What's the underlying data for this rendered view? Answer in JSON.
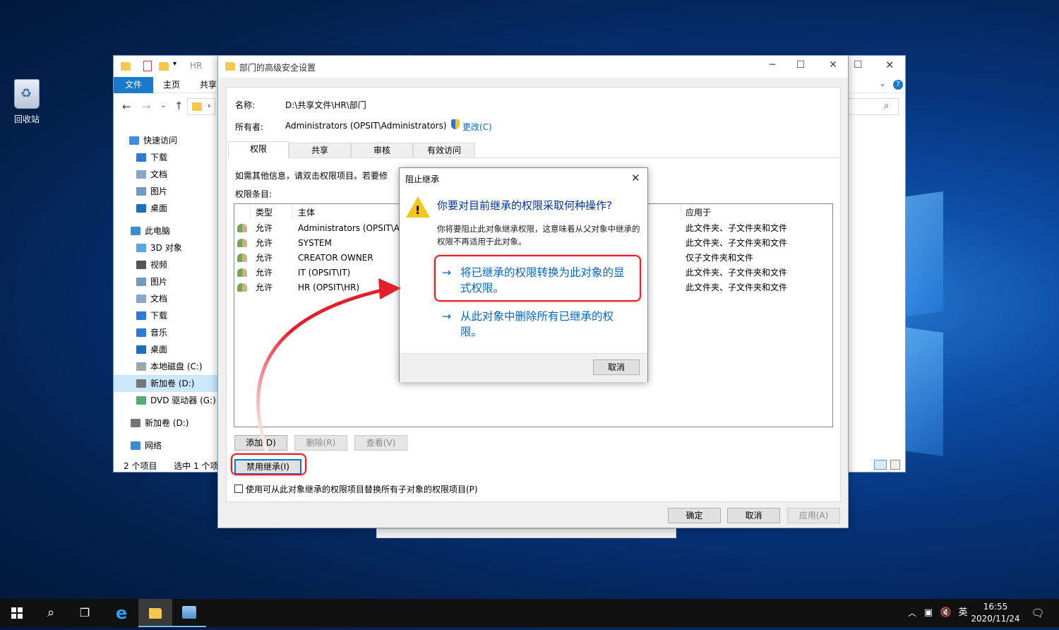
{
  "desktop": {
    "recycle_bin": "回收站"
  },
  "explorer": {
    "title": "HR",
    "ribbon": {
      "file": "文件",
      "home": "主页",
      "share": "共享"
    },
    "nav": [
      {
        "label": "快速访问",
        "icon": "star-icon"
      },
      {
        "label": "下载",
        "icon": "download-icon"
      },
      {
        "label": "文档",
        "icon": "document-icon"
      },
      {
        "label": "图片",
        "icon": "picture-icon"
      },
      {
        "label": "桌面",
        "icon": "desktop-icon"
      },
      {
        "label": "此电脑",
        "icon": "computer-icon"
      },
      {
        "label": "3D 对象",
        "icon": "cube-icon"
      },
      {
        "label": "视频",
        "icon": "video-icon"
      },
      {
        "label": "图片",
        "icon": "picture-icon"
      },
      {
        "label": "文档",
        "icon": "document-icon"
      },
      {
        "label": "下载",
        "icon": "download-icon"
      },
      {
        "label": "音乐",
        "icon": "music-icon"
      },
      {
        "label": "桌面",
        "icon": "desktop-icon"
      },
      {
        "label": "本地磁盘 (C:)",
        "icon": "drive-icon"
      },
      {
        "label": "新加卷 (D:)",
        "icon": "drive-icon"
      },
      {
        "label": "DVD 驱动器 (G:) S",
        "icon": "dvd-icon"
      },
      {
        "label": "新加卷 (D:)",
        "icon": "drive-icon"
      },
      {
        "label": "网络",
        "icon": "network-icon"
      }
    ],
    "status": {
      "count": "2 个项目",
      "selected": "选中 1 个项"
    }
  },
  "security": {
    "title": "部门的高级安全设置",
    "name_label": "名称:",
    "name_value": "D:\\共享文件\\HR\\部门",
    "owner_label": "所有者:",
    "owner_value": "Administrators (OPSIT\\Administrators)",
    "change_link": "更改(C)",
    "tabs": [
      "权限",
      "共享",
      "审核",
      "有效访问"
    ],
    "info_text": "如需其他信息，请双击权限项目。若要修",
    "entries_label": "权限条目:",
    "columns": {
      "type": "类型",
      "principal": "主体",
      "applies": "应用于"
    },
    "rows": [
      {
        "type": "允许",
        "principal": "Administrators (OPSIT\\Ad",
        "applies": "此文件夹、子文件夹和文件"
      },
      {
        "type": "允许",
        "principal": "SYSTEM",
        "applies": "此文件夹、子文件夹和文件"
      },
      {
        "type": "允许",
        "principal": "CREATOR OWNER",
        "applies": "仅子文件夹和文件"
      },
      {
        "type": "允许",
        "principal": "IT (OPSIT\\IT)",
        "applies": "此文件夹、子文件夹和文件"
      },
      {
        "type": "允许",
        "principal": "HR (OPSIT\\HR)",
        "applies": "此文件夹、子文件夹和文件"
      }
    ],
    "add": "添加(D)",
    "remove": "删除(R)",
    "view": "查看(V)",
    "disable_inheritance": "禁用继承(I)",
    "replace_checkbox": "使用可从此对象继承的权限项目替换所有子对象的权限项目(P)",
    "ok": "确定",
    "cancel": "取消",
    "apply": "应用(A)"
  },
  "popup": {
    "title": "阻止继承",
    "question": "你要对目前继承的权限采取何种操作?",
    "description": "你将要阻止此对象继承权限，这意味着从父对象中继承的权限不再适用于此对象。",
    "convert_line1": "将已继承的权限转换为此对象的显",
    "convert_line2": "式权限。",
    "remove_line1": "从此对象中删除所有已继承的权",
    "remove_line2": "限。",
    "arrow": "→",
    "cancel": "取消"
  },
  "taskbar": {
    "time": "16:55",
    "date": "2020/11/24",
    "ime": "英"
  },
  "colors": {
    "accent": "#0078d7",
    "annotation": "#e3202a",
    "link": "#0066cc"
  }
}
